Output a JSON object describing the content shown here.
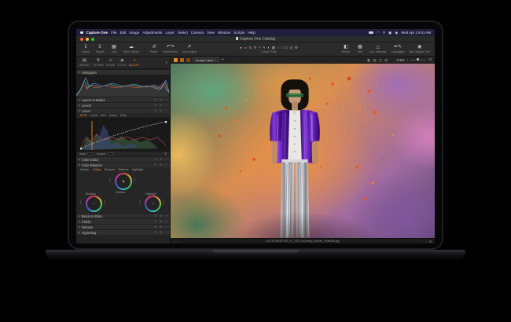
{
  "menu_bar": {
    "app_name": "Capture One",
    "items": [
      "File",
      "Edit",
      "Image",
      "Adjustments",
      "Layer",
      "Select",
      "Camera",
      "View",
      "Window",
      "Scripts",
      "Help"
    ],
    "clock": "Wed Apr 1 9:41 AM"
  },
  "window": {
    "title": "Capture One Catalog"
  },
  "toolbar": {
    "left": {
      "import": "Import",
      "export": "Export",
      "cull": "Cull",
      "work_online": "Work Online",
      "reset": "Reset",
      "undo_redo": "Undo/Redo",
      "auto_adjust": "Auto Adjust"
    },
    "cursor_tools_label": "Cursor Tools",
    "right": {
      "before": "Before",
      "grid": "Grid",
      "exp_warning": "Exp. Warning",
      "copyrights": "Copyrights",
      "my_capture_one": "My Capture One"
    }
  },
  "tool_tabs": {
    "items": [
      "LIBRARY",
      "TETHER",
      "SHAPE",
      "STYLE",
      "ADJUST"
    ],
    "active": "ADJUST"
  },
  "panel": {
    "histogram": {
      "title": "Histogram"
    },
    "layers_masks": {
      "title": "Layers & Masks"
    },
    "levels": {
      "title": "Levels"
    },
    "curve": {
      "title": "Curve",
      "tabs": [
        "RGB",
        "Luma",
        "Red",
        "Green",
        "Blue"
      ],
      "active_tab": "RGB",
      "input_label": "Input",
      "output_label": "Output"
    },
    "color_editor": {
      "title": "Color Editor"
    },
    "color_balance": {
      "title": "Color Balance",
      "tabs": [
        "Master",
        "3-Way",
        "Shadow",
        "Midtone",
        "Highlight"
      ],
      "active_tab": "3-Way",
      "wheel_labels": [
        "Midtone",
        "Shadow",
        "Highlight"
      ]
    },
    "black_white": {
      "title": "Black & White"
    },
    "clarity": {
      "title": "Clarity"
    },
    "dehaze": {
      "title": "Dehaze"
    },
    "vignetting": {
      "title": "Vignetting"
    }
  },
  "viewer": {
    "layer_selector": "Image Layer",
    "zoom_level": "176%",
    "filename": "KOTHSHEEY903_H_7.05_NoJersey_Before_Final056.jpg"
  },
  "colors": {
    "accent_orange": "#e8862d",
    "menu_bar_blue": "#1f1f3c",
    "traffic_red": "#ff5f57",
    "traffic_yellow": "#febc2e",
    "traffic_green": "#28c840",
    "splatter_orange": "#e85c1f"
  }
}
